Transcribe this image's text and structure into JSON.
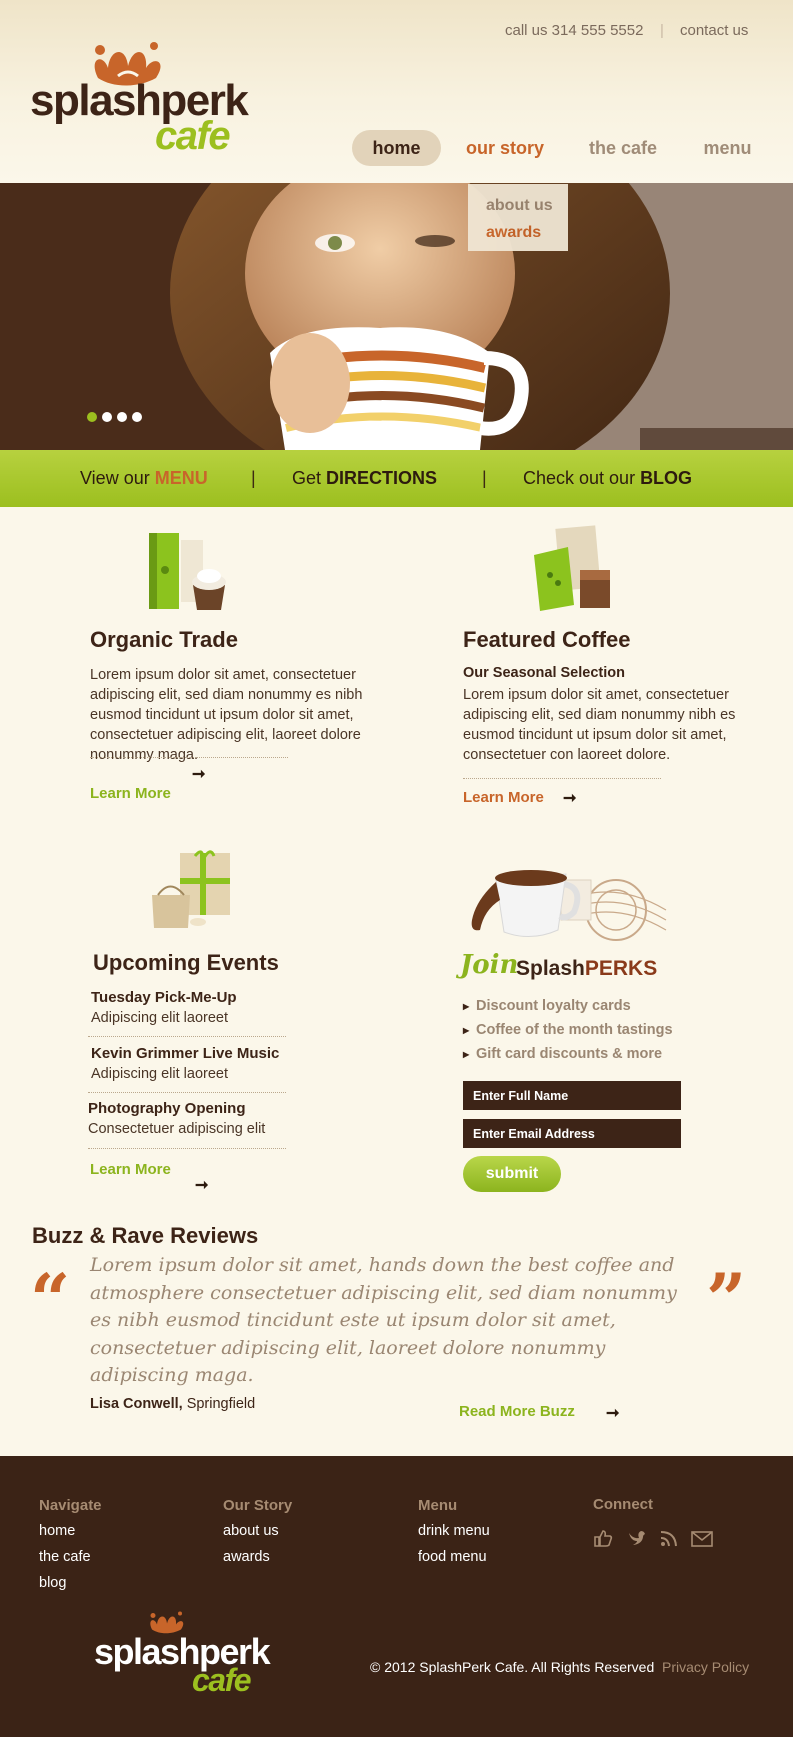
{
  "header": {
    "phone": "call us 314 555 5552",
    "divider": "|",
    "contact": "contact us",
    "logo": {
      "line1": "splashperk",
      "line2": "cafe"
    },
    "nav": [
      "home",
      "our story",
      "the cafe",
      "menu"
    ],
    "dropdown": [
      "about us",
      "awards"
    ]
  },
  "hero": {
    "slides": 4,
    "active_slide": 1
  },
  "greenbar": {
    "items": [
      {
        "prefix": "View our ",
        "strong": "MENU"
      },
      {
        "prefix": "Get ",
        "strong": "DIRECTIONS"
      },
      {
        "prefix": "Check out our ",
        "strong": "BLOG"
      }
    ],
    "sep": "|"
  },
  "organic": {
    "title": "Organic Trade",
    "body": "Lorem ipsum dolor sit amet, consectetuer adipiscing elit, sed diam nonummy es nibh eusmod tincidunt ut ipsum dolor sit amet, consectetuer adipiscing elit, laoreet dolore nonummy maga.",
    "learn": "Learn More"
  },
  "featured": {
    "title": "Featured Coffee",
    "subtitle": "Our Seasonal Selection",
    "body": "Lorem ipsum dolor sit amet, consectetuer adipiscing elit, sed diam nonummy nibh es eusmod tincidunt ut ipsum dolor sit amet, consectetuer con laoreet dolore.",
    "learn": "Learn More"
  },
  "events": {
    "title": "Upcoming Events",
    "items": [
      {
        "name": "Tuesday Pick-Me-Up",
        "desc": "Adipiscing elit laoreet"
      },
      {
        "name": "Kevin Grimmer Live Music",
        "desc": "Adipiscing elit laoreet"
      },
      {
        "name": "Photography Opening",
        "desc": "Consectetuer adipiscing elit"
      }
    ],
    "learn": "Learn More"
  },
  "join": {
    "join": "Join",
    "brand1": "Splash",
    "brand2": "PERKS",
    "perks": [
      "Discount loyalty cards",
      "Coffee of the month tastings",
      "Gift card discounts & more"
    ],
    "name_placeholder": "Enter Full Name",
    "email_placeholder": "Enter Email Address",
    "submit": "submit"
  },
  "reviews": {
    "title": "Buzz & Rave Reviews",
    "open_quote": "“",
    "close_quote": "”",
    "quote": "Lorem ipsum dolor sit amet, hands down the best coffee and atmosphere consectetuer adipiscing elit, sed diam nonummy es nibh eusmod tincidunt este ut ipsum dolor sit amet, consectetuer adipiscing elit, laoreet dolore nonummy adipiscing maga.",
    "author": "Lisa Conwell,",
    "location": " Springfield",
    "read_more": "Read More Buzz"
  },
  "footer": {
    "navigate": {
      "head": "Navigate",
      "links": [
        "home",
        "the cafe",
        "blog"
      ]
    },
    "story": {
      "head": "Our Story",
      "links": [
        "about us",
        "awards"
      ]
    },
    "menu": {
      "head": "Menu",
      "links": [
        "drink menu",
        "food menu"
      ]
    },
    "connect": {
      "head": "Connect",
      "icons": [
        "thumbs-up-icon",
        "twitter-bird-icon",
        "rss-icon",
        "email-icon"
      ]
    },
    "copyright": "© 2012 SplashPerk Cafe. All Rights Reserved",
    "privacy": "Privacy Policy"
  },
  "colors": {
    "brown": "#3d2417",
    "orange": "#c8652a",
    "green": "#8cb41e",
    "cream": "#fbf7ea",
    "tan": "#a08c78"
  }
}
